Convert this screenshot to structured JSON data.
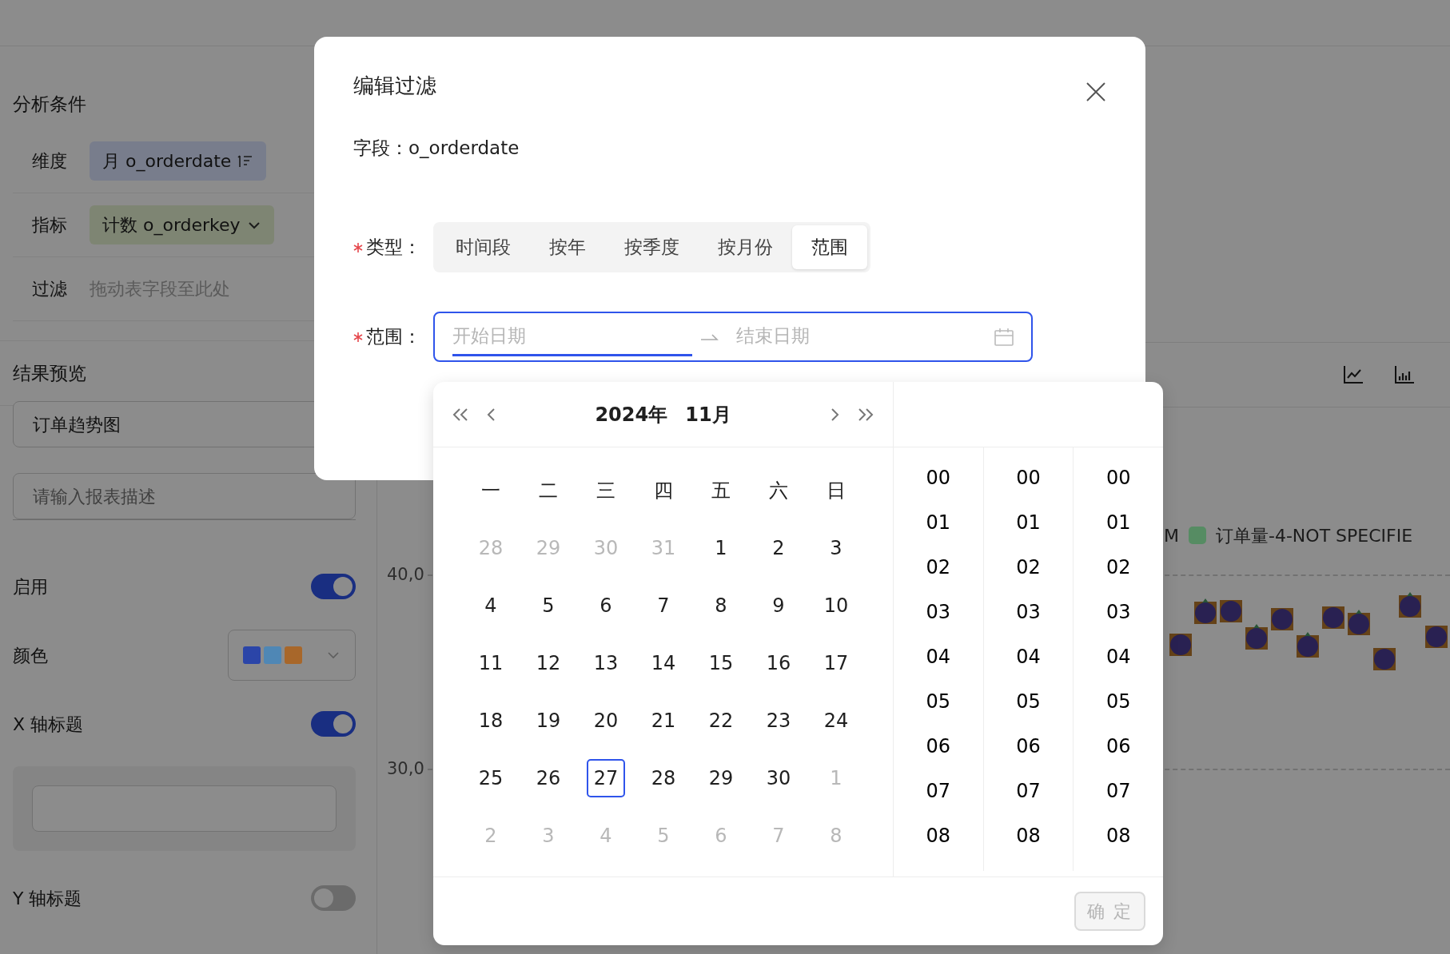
{
  "sidebar": {
    "conditions_title": "分析条件",
    "conditions": [
      {
        "kind": "dimension",
        "label": "维度",
        "value": "月 o_orderdate"
      },
      {
        "kind": "metric",
        "label": "指标",
        "value": "计数 o_orderkey"
      },
      {
        "kind": "drop",
        "label": "过滤",
        "placeholder": "拖动表字段至此处"
      }
    ],
    "preview_title": "结果预览",
    "report_title": "订单趋势图",
    "description": {
      "placeholder": "请输入报表描述"
    },
    "settings": [
      {
        "kind": "switch",
        "label": "启用",
        "on": true
      },
      {
        "kind": "palette",
        "label": "颜色",
        "swatches": [
          {
            "color": "#2b45a8"
          },
          {
            "color": "#4f87b5"
          },
          {
            "color": "#a8672a"
          }
        ]
      },
      {
        "kind": "switch",
        "label": "X 轴标题",
        "on": true
      },
      {
        "kind": "switch",
        "label": "Y 轴标题",
        "on": false
      }
    ]
  },
  "chart": {
    "y_ticks": [
      "40,0",
      "30,0"
    ],
    "legend": [
      {
        "label": "M"
      },
      {
        "label": "订单量-4-NOT SPECIFIE",
        "color": "#568c63"
      }
    ]
  },
  "modal": {
    "title": "编辑过滤",
    "field": "字段：o_orderdate",
    "type": {
      "label": "类型：",
      "required": true,
      "options": [
        {
          "label": "时间段",
          "selected": false
        },
        {
          "label": "按年",
          "selected": false
        },
        {
          "label": "按季度",
          "selected": false
        },
        {
          "label": "按月份",
          "selected": false
        },
        {
          "label": "范围",
          "selected": true
        }
      ]
    },
    "range": {
      "label": "范围：",
      "required": true,
      "start": {
        "placeholder": "开始日期",
        "active": true
      },
      "end": {
        "placeholder": "结束日期",
        "active": false
      }
    }
  },
  "picker": {
    "year": "2024年",
    "month": "11月",
    "weekdays": [
      "一",
      "二",
      "三",
      "四",
      "五",
      "六",
      "日"
    ],
    "weeks": [
      [
        {
          "d": "28",
          "in_month": false,
          "today": false
        },
        {
          "d": "29",
          "in_month": false,
          "today": false
        },
        {
          "d": "30",
          "in_month": false,
          "today": false
        },
        {
          "d": "31",
          "in_month": false,
          "today": false
        },
        {
          "d": "1",
          "in_month": true,
          "today": false
        },
        {
          "d": "2",
          "in_month": true,
          "today": false
        },
        {
          "d": "3",
          "in_month": true,
          "today": false
        }
      ],
      [
        {
          "d": "4",
          "in_month": true,
          "today": false
        },
        {
          "d": "5",
          "in_month": true,
          "today": false
        },
        {
          "d": "6",
          "in_month": true,
          "today": false
        },
        {
          "d": "7",
          "in_month": true,
          "today": false
        },
        {
          "d": "8",
          "in_month": true,
          "today": false
        },
        {
          "d": "9",
          "in_month": true,
          "today": false
        },
        {
          "d": "10",
          "in_month": true,
          "today": false
        }
      ],
      [
        {
          "d": "11",
          "in_month": true,
          "today": false
        },
        {
          "d": "12",
          "in_month": true,
          "today": false
        },
        {
          "d": "13",
          "in_month": true,
          "today": false
        },
        {
          "d": "14",
          "in_month": true,
          "today": false
        },
        {
          "d": "15",
          "in_month": true,
          "today": false
        },
        {
          "d": "16",
          "in_month": true,
          "today": false
        },
        {
          "d": "17",
          "in_month": true,
          "today": false
        }
      ],
      [
        {
          "d": "18",
          "in_month": true,
          "today": false
        },
        {
          "d": "19",
          "in_month": true,
          "today": false
        },
        {
          "d": "20",
          "in_month": true,
          "today": false
        },
        {
          "d": "21",
          "in_month": true,
          "today": false
        },
        {
          "d": "22",
          "in_month": true,
          "today": false
        },
        {
          "d": "23",
          "in_month": true,
          "today": false
        },
        {
          "d": "24",
          "in_month": true,
          "today": false
        }
      ],
      [
        {
          "d": "25",
          "in_month": true,
          "today": false
        },
        {
          "d": "26",
          "in_month": true,
          "today": false
        },
        {
          "d": "27",
          "in_month": true,
          "today": true
        },
        {
          "d": "28",
          "in_month": true,
          "today": false
        },
        {
          "d": "29",
          "in_month": true,
          "today": false
        },
        {
          "d": "30",
          "in_month": true,
          "today": false
        },
        {
          "d": "1",
          "in_month": false,
          "today": false
        }
      ],
      [
        {
          "d": "2",
          "in_month": false,
          "today": false
        },
        {
          "d": "3",
          "in_month": false,
          "today": false
        },
        {
          "d": "4",
          "in_month": false,
          "today": false
        },
        {
          "d": "5",
          "in_month": false,
          "today": false
        },
        {
          "d": "6",
          "in_month": false,
          "today": false
        },
        {
          "d": "7",
          "in_month": false,
          "today": false
        },
        {
          "d": "8",
          "in_month": false,
          "today": false
        }
      ]
    ],
    "time_columns": [
      [
        "00",
        "01",
        "02",
        "03",
        "04",
        "05",
        "06",
        "07",
        "08"
      ],
      [
        "00",
        "01",
        "02",
        "03",
        "04",
        "05",
        "06",
        "07",
        "08"
      ],
      [
        "00",
        "01",
        "02",
        "03",
        "04",
        "05",
        "06",
        "07",
        "08"
      ]
    ],
    "ok_button": {
      "label": "确 定",
      "disabled": true
    }
  }
}
